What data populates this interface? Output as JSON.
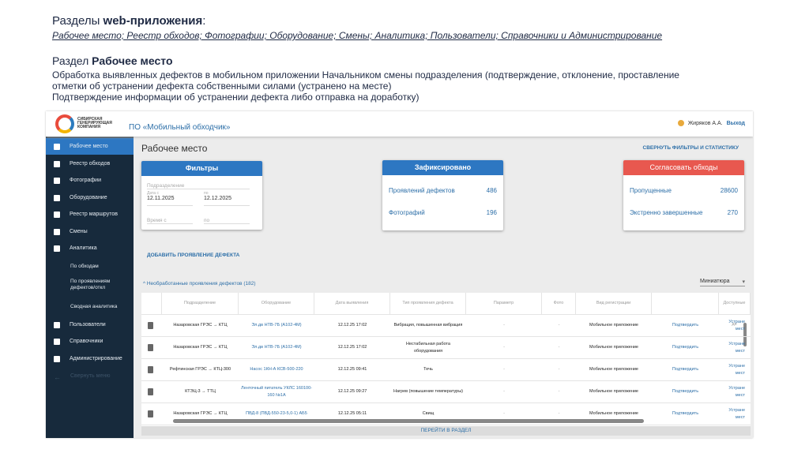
{
  "slide": {
    "title_prefix": "Разделы ",
    "title_bold": "web-приложения",
    "title_suffix": ":",
    "sections_list": "Рабочее место; Реестр обходов; Фотографии; Оборудование; Смены; Аналитика;  Пользователи; Справочники и Администрирование",
    "section_prefix": "Раздел ",
    "section_bold": "Рабочее место",
    "desc1": "Обработка выявленных дефектов в мобильном приложении Начальником смены подразделения (подтверждение, отклонение, проставление отметки об устранении дефекта собственными силами (устранено на месте)",
    "desc2": "Подтверждение информации об устранении дефекта либо отправка на доработку)"
  },
  "app": {
    "logo_text": "СИБИРСКАЯ ГЕНЕРИРУЮЩАЯ КОМПАНИЯ",
    "title": "ПО «Мобильный обходчик»",
    "user": "Жиряков А.А.",
    "logout": "Выход",
    "sidebar": [
      {
        "label": "Рабочее место"
      },
      {
        "label": "Реестр обходов"
      },
      {
        "label": "Фотографии"
      },
      {
        "label": "Оборудование"
      },
      {
        "label": "Реестр маршрутов"
      },
      {
        "label": "Смены"
      },
      {
        "label": "Аналитика"
      },
      {
        "label": "По обходам"
      },
      {
        "label": "По проявлениям дефектов/откл"
      },
      {
        "label": "Сводная аналитика"
      },
      {
        "label": "Пользователи"
      },
      {
        "label": "Справочники"
      },
      {
        "label": "Администрирование"
      },
      {
        "label": "Свернуть меню"
      }
    ],
    "page_title": "Рабочее место",
    "collapse": "СВЕРНУТЬ ФИЛЬТРЫ И СТАТИСТИКУ",
    "filters": {
      "title": "Фильтры",
      "division_placeholder": "Подразделение",
      "date_from_label": "Дата с",
      "date_from": "12.11.2025",
      "date_to_label": "по",
      "date_to": "12.12.2025",
      "time_from": "Время с",
      "time_to": "по"
    },
    "fixed": {
      "title": "Зафиксировано",
      "defects_label": "Проявлений дефектов",
      "defects": "486",
      "photos_label": "Фотографий",
      "photos": "196"
    },
    "agree": {
      "title": "Согласовать обходы",
      "missed_label": "Пропущенные",
      "missed": "28600",
      "emergency_label": "Экстренно завершенные",
      "emergency": "270"
    },
    "add_defect": "ДОБАВИТЬ ПРОЯВЛЕНИЕ ДЕФЕКТА",
    "group": "Необработанные проявления дефектов (182)",
    "view": "Миниатюра",
    "columns": [
      "",
      "Подразделение",
      "Оборудование",
      "Дата выявления",
      "Тип проявления дефекта",
      "Параметр",
      "Фото",
      "Вид регистрации",
      "",
      "Доступные де"
    ],
    "rows": [
      [
        "Назаровская ГРЭС → КТЦ",
        "Эл.дв НТВ-7Б (А102-4М)",
        "12.12.25 17:02",
        "Вибрация, повышенная вибрация",
        "-",
        "-",
        "Мобильное приложение",
        "Подтвердить",
        "Устране мест"
      ],
      [
        "Назаровская ГРЭС → КТЦ",
        "Эл.дв НТВ-7Б (А102-4М)",
        "12.12.25 17:02",
        "Нестабильная работа оборудования",
        "-",
        "-",
        "Мобильное приложение",
        "Подтвердить",
        "Устране мест"
      ],
      [
        "Рефтинская ГРЭС → КТЦ-300",
        "Насос 1КН-А КСВ-500-220",
        "12.12.25 09:41",
        "Течь",
        "-",
        "-",
        "Мобильное приложение",
        "Подтвердить",
        "Устране мест"
      ],
      [
        "КТЭЦ-3 → ТТЦ",
        "Ленточный питатель УКЛС 160100-160 №1А",
        "12.12.25 09:27",
        "Нагрев (повышение температуры)",
        "-",
        "-",
        "Мобильное приложение",
        "Подтвердить",
        "Устране мест"
      ],
      [
        "Назаровская ГРЭС → КТЦ",
        "ПВД-8 (ПВД-550-23-5,0-1) АБ5",
        "12.12.25 05:11",
        "Свищ",
        "-",
        "-",
        "Мобильное приложение",
        "Подтвердить",
        "Устране мест"
      ]
    ],
    "footer": "ПЕРЕЙТИ В РАЗДЕЛ"
  },
  "colors": {
    "sidebar": "#172a3c",
    "accent": "#2d77c2",
    "red": "#e8584f"
  }
}
